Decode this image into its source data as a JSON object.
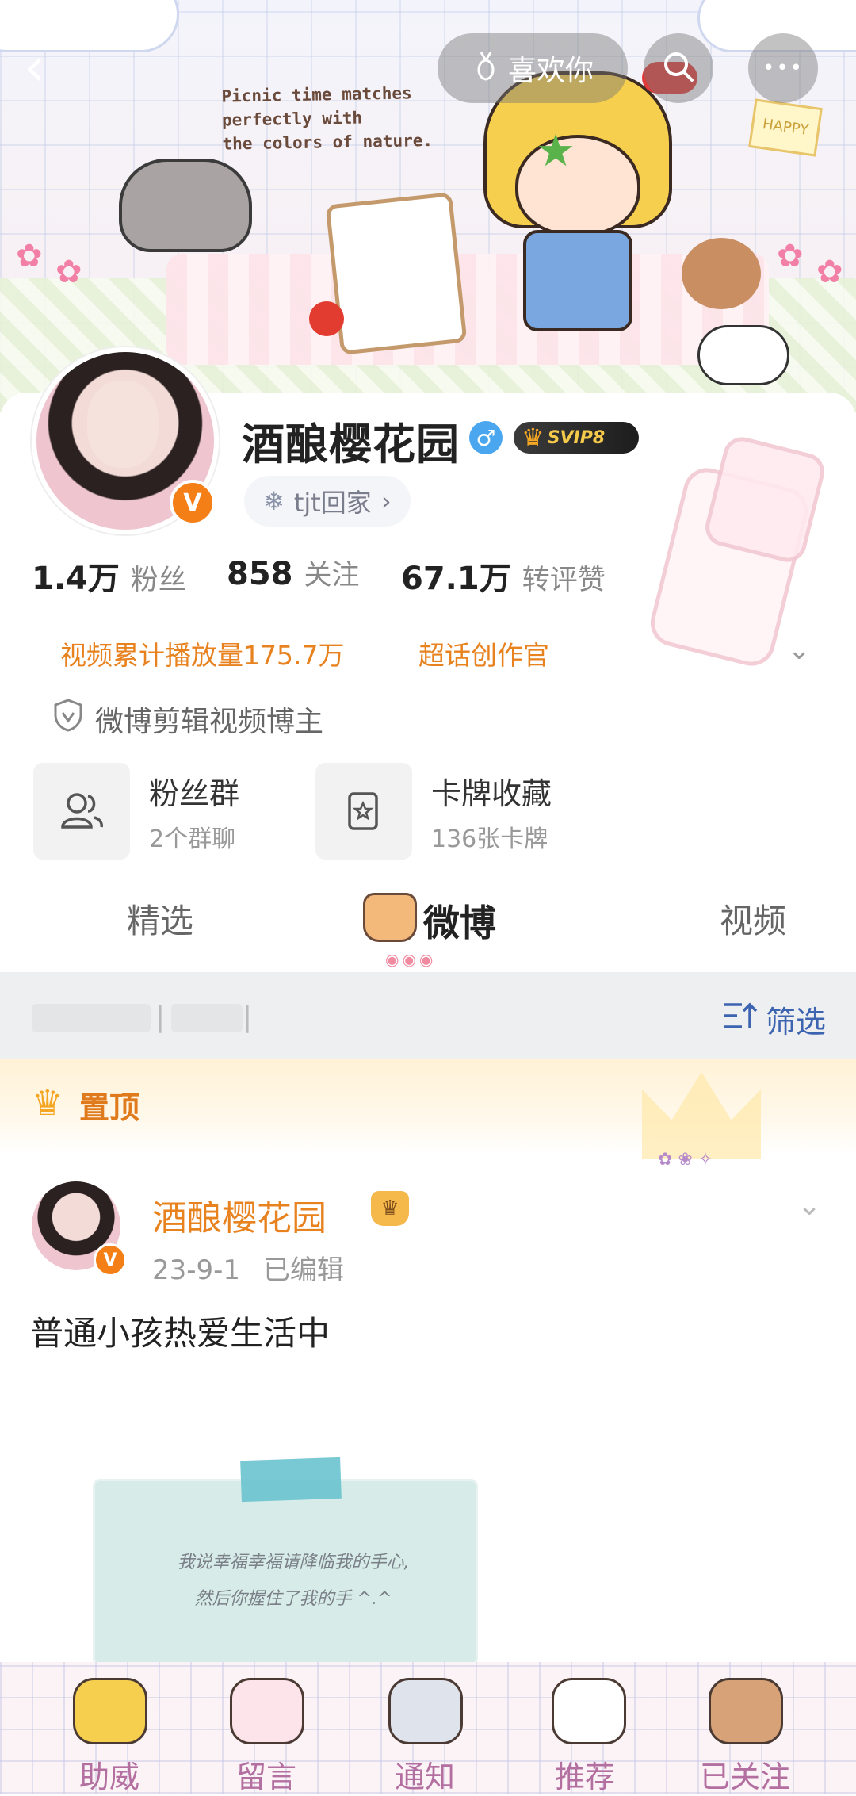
{
  "banner": {
    "text_lines": [
      "Picnic time matches",
      "perfectly with",
      "the colors of nature."
    ],
    "tag": "HAPPY"
  },
  "top_bar": {
    "back_glyph": "‹",
    "like_label": "喜欢你",
    "search_icon": "search-icon",
    "more_glyph": "•••"
  },
  "profile": {
    "name": "酒酿樱花园",
    "verified_glyph": "V",
    "gender_glyph": "♂",
    "svip_label": "SVIP8",
    "location_label": "tjt回家",
    "location_glyph": "❄",
    "location_chevron": "›",
    "stats": [
      {
        "value": "1.4万",
        "label": "粉丝"
      },
      {
        "value": "858",
        "label": "关注"
      },
      {
        "value": "67.1万",
        "label": "转评赞"
      }
    ],
    "honors": [
      "视频累计播放量175.7万",
      "超话创作官"
    ],
    "certification": "微博剪辑视频博主",
    "cards": [
      {
        "title": "粉丝群",
        "subtitle": "2个群聊",
        "icon": "people-icon"
      },
      {
        "title": "卡牌收藏",
        "subtitle": "136张卡牌",
        "icon": "card-icon"
      }
    ]
  },
  "tabs": [
    {
      "label": "精选",
      "active": false
    },
    {
      "label": "微博",
      "active": true
    },
    {
      "label": "视频",
      "active": false
    }
  ],
  "filter": {
    "label": "筛选",
    "separator": "|"
  },
  "pinned": {
    "label": "置顶"
  },
  "post": {
    "author": "酒酿樱花园",
    "date": "23-9-1",
    "edited": "已编辑",
    "text": "普通小孩热爱生活中",
    "image_text": [
      "我说幸福幸福请降临我的手心,",
      "然后你握住了我的手 ^.^"
    ]
  },
  "bottom_nav": [
    {
      "label": "助威",
      "icon": "cheer-icon"
    },
    {
      "label": "留言",
      "icon": "envelope-icon"
    },
    {
      "label": "通知",
      "icon": "phone-icon"
    },
    {
      "label": "推荐",
      "icon": "kitty-icon"
    },
    {
      "label": "已关注",
      "icon": "dog-icon"
    }
  ],
  "colors": {
    "accent_orange": "#e8821f",
    "link_blue": "#3d64b0",
    "nav_pink": "#b46fa1",
    "verified_orange": "#f57f17"
  }
}
